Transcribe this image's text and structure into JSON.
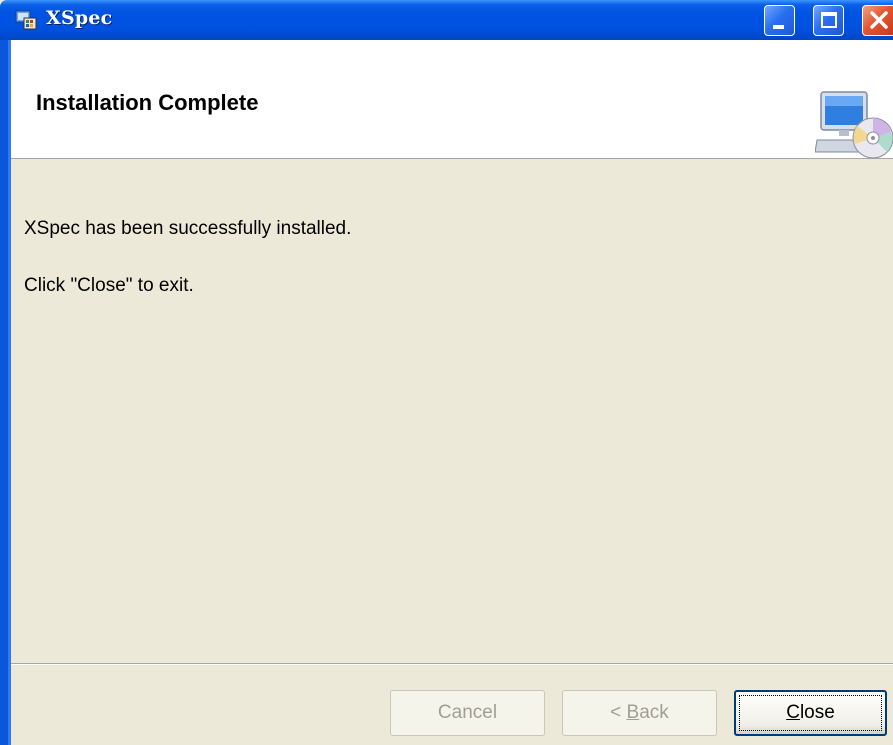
{
  "window": {
    "title": "XSpec",
    "title_bar_color": "#0054e3"
  },
  "banner": {
    "title": "Installation Complete",
    "icon": "computer-with-cd-icon"
  },
  "body": {
    "message": "XSpec has been successfully installed.",
    "instruction": "Click \"Close\" to exit."
  },
  "buttons": {
    "cancel_label": "Cancel",
    "back_prefix": "< ",
    "back_accel": "B",
    "back_rest": "ack",
    "close_accel": "C",
    "close_rest": "lose"
  }
}
